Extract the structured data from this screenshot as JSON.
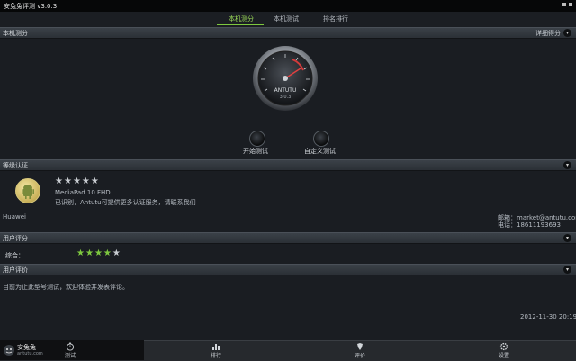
{
  "window": {
    "title": "安兔兔评测 v3.0.3"
  },
  "tabs": [
    {
      "label": "本机测分",
      "active": true
    },
    {
      "label": "本机测试",
      "active": false
    },
    {
      "label": "排名排行",
      "active": false
    }
  ],
  "sections": {
    "score": {
      "label": "本机测分",
      "right_text": "详细得分"
    },
    "cert": {
      "label": "等级认证"
    },
    "rating": {
      "label": "用户评分"
    },
    "comments": {
      "label": "用户评价"
    }
  },
  "gauge": {
    "brand": "ANTUTU",
    "sub": "3.0.3"
  },
  "actions": {
    "start_label": "开始测试",
    "custom_label": "自定义测试"
  },
  "device": {
    "model": "MediaPad 10 FHD",
    "cert_text": "已识别，Antutu可提供更多认证服务，请联系我们",
    "brand": "Huawei",
    "contact_email": "邮箱：market@antutu.com",
    "contact_phone": "电话：18611193693",
    "stars_filled": 0,
    "stars_total": 5
  },
  "rating": {
    "label": "综合：",
    "stars_filled": 4,
    "stars_total": 5
  },
  "comment": {
    "text": "目前为止此型号测试，欢迎体验并发表评论。",
    "timestamp": "2012-11-30 20:19:15"
  },
  "bottom_nav": [
    {
      "label": "测试",
      "icon": "timer-icon"
    },
    {
      "label": "排行",
      "icon": "rank-icon"
    },
    {
      "label": "评价",
      "icon": "tool-icon"
    },
    {
      "label": "设置",
      "icon": "settings-icon"
    }
  ],
  "logo": {
    "brand": "安兔兔",
    "sub": "antutu.com"
  },
  "colors": {
    "accent": "#7ec83f",
    "star_fill": "#7ec83f",
    "star_empty": "#c9cdd2"
  }
}
